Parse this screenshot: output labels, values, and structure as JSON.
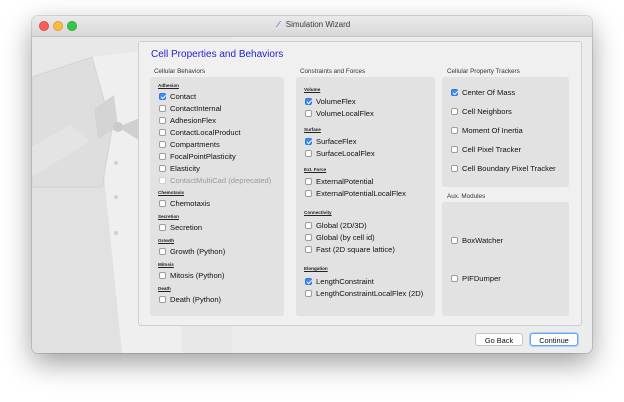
{
  "window": {
    "title": "Simulation Wizard"
  },
  "page": {
    "heading": "Cell Properties and Behaviors"
  },
  "columns": {
    "behaviors": {
      "title": "Cellular Behaviors",
      "groups": [
        {
          "name": "Adhesion",
          "items": [
            {
              "label": "Contact",
              "checked": true
            },
            {
              "label": "ContactInternal",
              "checked": false
            },
            {
              "label": "AdhesionFlex",
              "checked": false
            },
            {
              "label": "ContactLocalProduct",
              "checked": false
            },
            {
              "label": "Compartments",
              "checked": false
            },
            {
              "label": "FocalPointPlasticity",
              "checked": false
            },
            {
              "label": "Elasticity",
              "checked": false
            },
            {
              "label": "ContactMultiCad (deprecated)",
              "checked": false,
              "disabled": true
            }
          ]
        },
        {
          "name": "Chemotaxis",
          "items": [
            {
              "label": "Chemotaxis",
              "checked": false
            }
          ]
        },
        {
          "name": "Secretion",
          "items": [
            {
              "label": "Secretion",
              "checked": false
            }
          ]
        },
        {
          "name": "Growth",
          "items": [
            {
              "label": "Growth (Python)",
              "checked": false
            }
          ]
        },
        {
          "name": "Mitosis",
          "items": [
            {
              "label": "Mitosis (Python)",
              "checked": false
            }
          ]
        },
        {
          "name": "Death",
          "items": [
            {
              "label": "Death (Python)",
              "checked": false
            }
          ]
        }
      ]
    },
    "constraints": {
      "title": "Constraints and Forces",
      "groups": [
        {
          "name": "Volume",
          "items": [
            {
              "label": "VolumeFlex",
              "checked": true
            },
            {
              "label": "VolumeLocalFlex",
              "checked": false
            }
          ]
        },
        {
          "name": "Surface",
          "items": [
            {
              "label": "SurfaceFlex",
              "checked": true
            },
            {
              "label": "SurfaceLocalFlex",
              "checked": false
            }
          ]
        },
        {
          "name": "Ext. Force",
          "items": [
            {
              "label": "ExternalPotential",
              "checked": false
            },
            {
              "label": "ExternalPotentialLocalFlex",
              "checked": false
            }
          ]
        },
        {
          "name": "Connectivity",
          "items": [
            {
              "label": "Global (2D/3D)",
              "checked": false
            },
            {
              "label": "Global (by cell id)",
              "checked": false
            },
            {
              "label": "Fast (2D square lattice)",
              "checked": false
            }
          ]
        },
        {
          "name": "Elongation",
          "items": [
            {
              "label": "LengthConstraint",
              "checked": true
            },
            {
              "label": "LengthConstraintLocalFlex (2D)",
              "checked": false
            }
          ]
        }
      ]
    },
    "trackers": {
      "title": "Cellular Property Trackers",
      "items": [
        {
          "label": "Center Of Mass",
          "checked": true
        },
        {
          "label": "Cell Neighbors",
          "checked": false
        },
        {
          "label": "Moment Of Inertia",
          "checked": false
        },
        {
          "label": "Cell Pixel Tracker",
          "checked": false
        },
        {
          "label": "Cell Boundary Pixel Tracker",
          "checked": false
        }
      ]
    },
    "aux": {
      "title": "Aux. Modules",
      "items": [
        {
          "label": "BoxWatcher",
          "checked": false
        },
        {
          "label": "PIFDumper",
          "checked": false
        }
      ]
    }
  },
  "buttons": {
    "back": "Go Back",
    "continue": "Continue"
  }
}
